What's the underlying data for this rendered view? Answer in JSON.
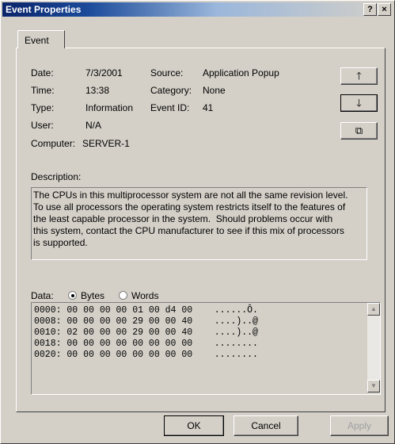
{
  "window": {
    "title": "Event Properties",
    "help_label": "?",
    "close_label": "×"
  },
  "tabs": [
    {
      "label": "Event"
    }
  ],
  "fields": {
    "date_label": "Date:",
    "date_value": "7/3/2001",
    "time_label": "Time:",
    "time_value": "13:38",
    "type_label": "Type:",
    "type_value": "Information",
    "user_label": "User:",
    "user_value": "N/A",
    "computer_label": "Computer:",
    "computer_value": "SERVER-1",
    "source_label": "Source:",
    "source_value": "Application Popup",
    "category_label": "Category:",
    "category_value": "None",
    "eventid_label": "Event ID:",
    "eventid_value": "41"
  },
  "side_buttons": {
    "up_glyph": "🡑",
    "down_glyph": "🡓",
    "copy_glyph": "⧉"
  },
  "description": {
    "label": "Description:",
    "text": "The CPUs in this multiprocessor system are not all the same revision level.\nTo use all processors the operating system restricts itself to the features of\nthe least capable processor in the system.  Should problems occur with\nthis system, contact the CPU manufacturer to see if this mix of processors\nis supported."
  },
  "data": {
    "label": "Data:",
    "bytes_label": "Bytes",
    "words_label": "Words",
    "selected": "Bytes",
    "rows": [
      "0000: 00 00 00 00 01 00 d4 00    ......Ô.",
      "0008: 00 00 00 00 29 00 00 40    ....)..@",
      "0010: 02 00 00 00 29 00 00 40    ....)..@",
      "0018: 00 00 00 00 00 00 00 00    ........",
      "0020: 00 00 00 00 00 00 00 00    ........"
    ]
  },
  "buttons": {
    "ok": "OK",
    "cancel": "Cancel",
    "apply": "Apply"
  }
}
